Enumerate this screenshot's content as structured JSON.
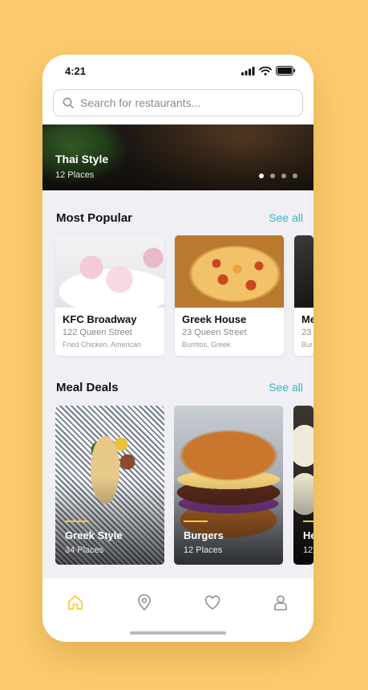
{
  "status_bar": {
    "time": "4:21"
  },
  "search": {
    "placeholder": "Search for restaurants..."
  },
  "hero": {
    "title": "Thai Style",
    "subtitle": "12 Places",
    "dots": 4,
    "active_dot": 0
  },
  "most_popular": {
    "title": "Most Popular",
    "see_all": "See all",
    "cards": [
      {
        "name": "KFC Broadway",
        "address": "122 Queen Street",
        "tags": "Fried Chicken, American"
      },
      {
        "name": "Greek House",
        "address": "23 Queen Street",
        "tags": "Burritos, Greek"
      },
      {
        "name": "Me",
        "address": "23",
        "tags": "Bur"
      }
    ]
  },
  "meal_deals": {
    "title": "Meal Deals",
    "see_all": "See all",
    "cards": [
      {
        "name": "Greek Style",
        "subtitle": "34 Places"
      },
      {
        "name": "Burgers",
        "subtitle": "12 Places"
      },
      {
        "name": "He",
        "subtitle": "12"
      }
    ]
  },
  "tabbar": {
    "items": [
      "home-icon",
      "location-pin-icon",
      "heart-icon",
      "profile-icon"
    ],
    "active": "home-icon"
  },
  "colors": {
    "accent": "#fccb2e",
    "link": "#36b6c8",
    "background": "#fccb6e"
  }
}
